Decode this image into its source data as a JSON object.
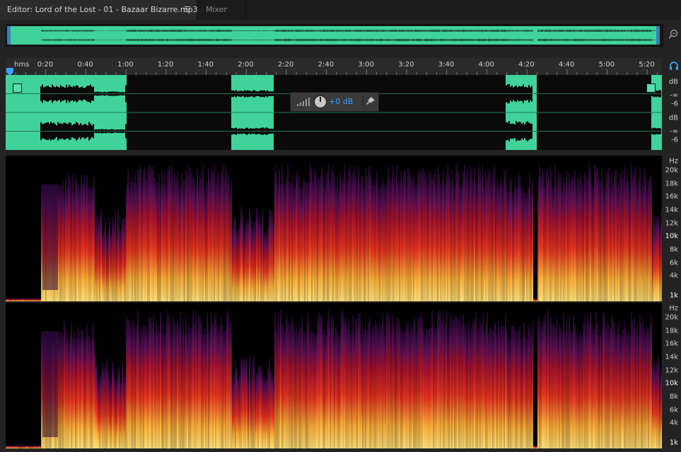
{
  "tabs": {
    "editor_label": "Editor: Lord of the Lost - 01 - Bazaar Bizarre.mp3",
    "menu_glyph": "☰",
    "mixer_label": "Mixer"
  },
  "ruler": {
    "format_label": "hms",
    "ticks": [
      "0:20",
      "0:40",
      "1:00",
      "1:20",
      "1:40",
      "2:00",
      "2:20",
      "2:40",
      "3:00",
      "3:20",
      "3:40",
      "4:00",
      "4:20",
      "4:40",
      "5:00",
      "5:20"
    ]
  },
  "hud": {
    "volume_label": "+0 dB"
  },
  "amplitude_scale": {
    "top": [
      "dB",
      "-∞",
      "-6"
    ],
    "bottom": [
      "dB",
      "-∞",
      "-6"
    ]
  },
  "frequency_scale": {
    "unit": "Hz",
    "labels": [
      "20k",
      "18k",
      "16k",
      "14k",
      "12k",
      "10k",
      "8k",
      "6k",
      "4k",
      "1k"
    ]
  },
  "colors": {
    "waveform_bg": "#3fd39b",
    "waveform_fg": "#0a0a0a",
    "selection": "#3ea0ff",
    "spectrum_hot": "#ffd25a",
    "spectrum_mid": "#d8281c",
    "spectrum_cold": "#3a1060"
  },
  "icons": {
    "zoom": "zoom-icon",
    "headphones": "headphones-icon",
    "pin": "pin-icon",
    "knob": "volume-knob-icon",
    "meter": "level-meter-icon"
  }
}
